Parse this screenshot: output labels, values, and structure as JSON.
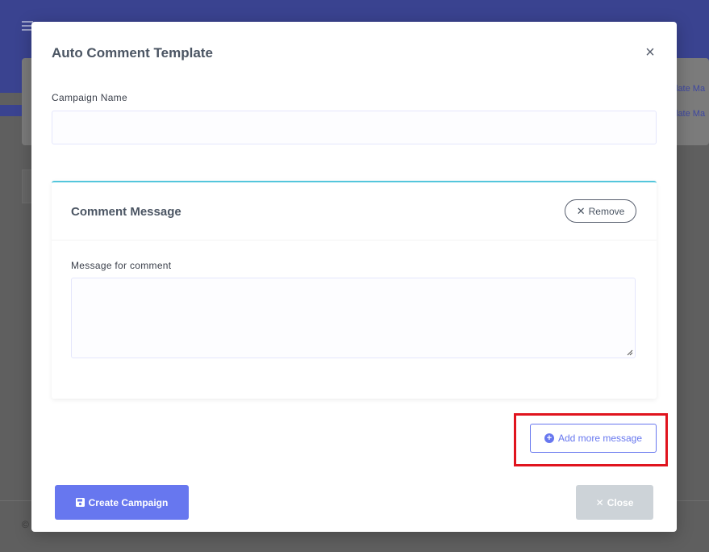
{
  "background": {
    "link_1": "late Ma",
    "link_2": "late Ma",
    "copyright": "©"
  },
  "modal": {
    "title": "Auto Comment Template",
    "close_icon": "×",
    "campaign_name_label": "Campaign Name",
    "campaign_name_value": "",
    "comment_card": {
      "title": "Comment Message",
      "remove_label": "Remove",
      "message_label": "Message for comment",
      "message_value": ""
    },
    "add_more_label": "Add more message",
    "create_label": "Create Campaign",
    "close_label": "Close"
  },
  "colors": {
    "primary": "#6777ef",
    "card_accent": "#54c6dc",
    "highlight": "#e0141e",
    "close_button": "#cdd3d8"
  }
}
